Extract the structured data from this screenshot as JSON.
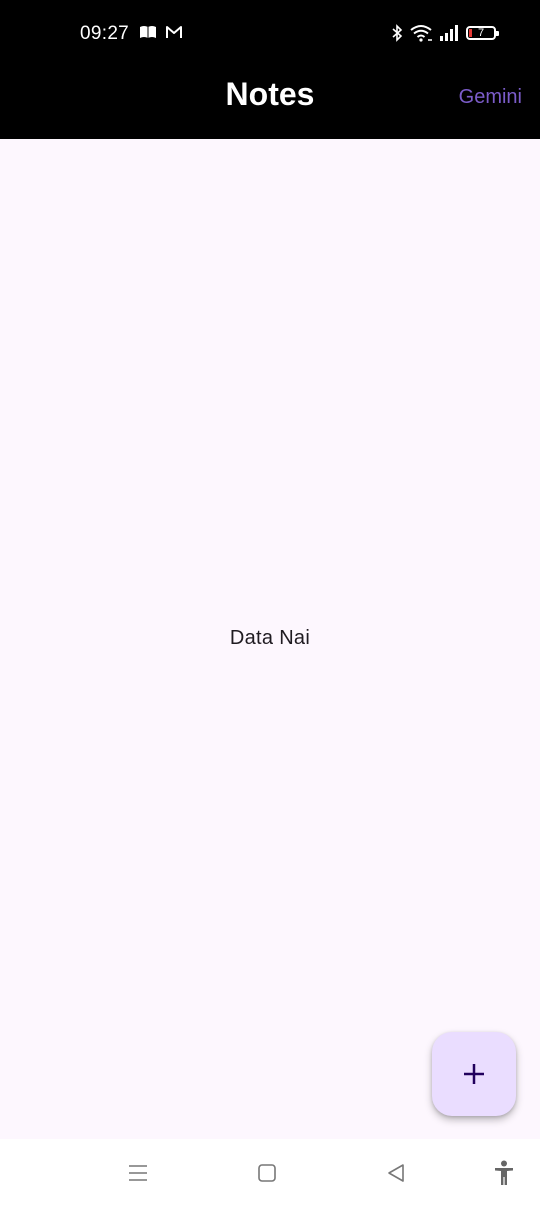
{
  "status_bar": {
    "time": "09:27",
    "battery_level": "7",
    "left_icons": [
      "book-icon",
      "gmail-icon"
    ],
    "right_icons": [
      "bluetooth-icon",
      "wifi-icon",
      "signal-icon",
      "battery-icon"
    ]
  },
  "app_bar": {
    "title": "Notes",
    "action_label": "Gemini"
  },
  "main": {
    "empty_message": "Data Nai"
  },
  "fab": {
    "icon": "plus-icon"
  },
  "nav_bar": {
    "icons": [
      "menu-icon",
      "home-icon",
      "back-icon",
      "accessibility-icon"
    ]
  },
  "colors": {
    "app_bar_bg": "#000000",
    "background": "#fdf7fe",
    "accent": "#7b5cc9",
    "fab_bg": "#eaddff",
    "fab_icon": "#21005d"
  }
}
